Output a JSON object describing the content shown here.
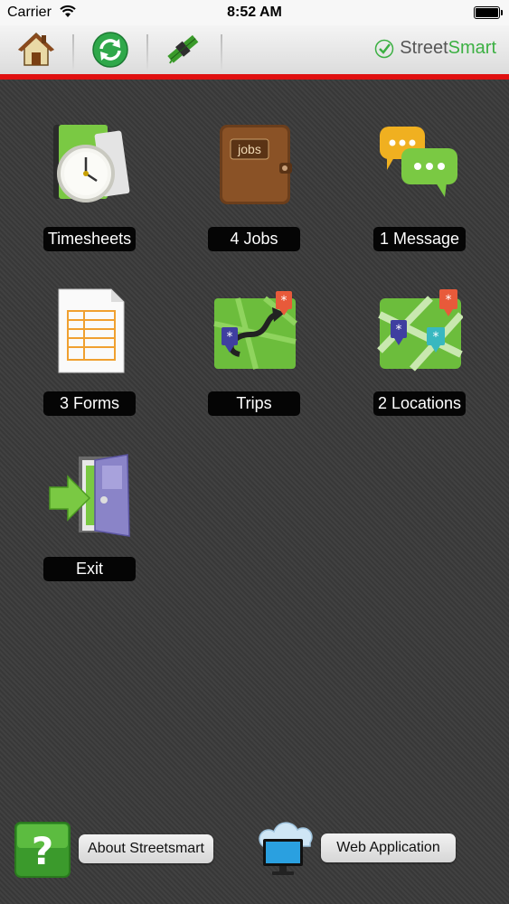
{
  "status_bar": {
    "carrier": "Carrier",
    "time": "8:52 AM"
  },
  "toolbar": {
    "brand_street": "Street",
    "brand_smart": "Smart",
    "buttons": [
      "home-icon",
      "sync-icon",
      "satellite-icon"
    ]
  },
  "menu": {
    "items": [
      {
        "label": "Timesheets",
        "icon": "timesheet-clock-icon"
      },
      {
        "label": "4 Jobs",
        "icon": "jobs-folder-icon",
        "icon_text": "jobs"
      },
      {
        "label": "1 Message",
        "icon": "message-bubbles-icon"
      },
      {
        "label": "3 Forms",
        "icon": "form-document-icon"
      },
      {
        "label": "Trips",
        "icon": "trips-map-icon"
      },
      {
        "label": "2 Locations",
        "icon": "locations-map-icon"
      },
      {
        "label": "Exit",
        "icon": "exit-door-icon"
      }
    ]
  },
  "footer": {
    "about_label": "About Streetsmart",
    "web_label": "Web Application"
  },
  "colors": {
    "accent_red": "#e01010",
    "brand_green": "#3cb043"
  }
}
